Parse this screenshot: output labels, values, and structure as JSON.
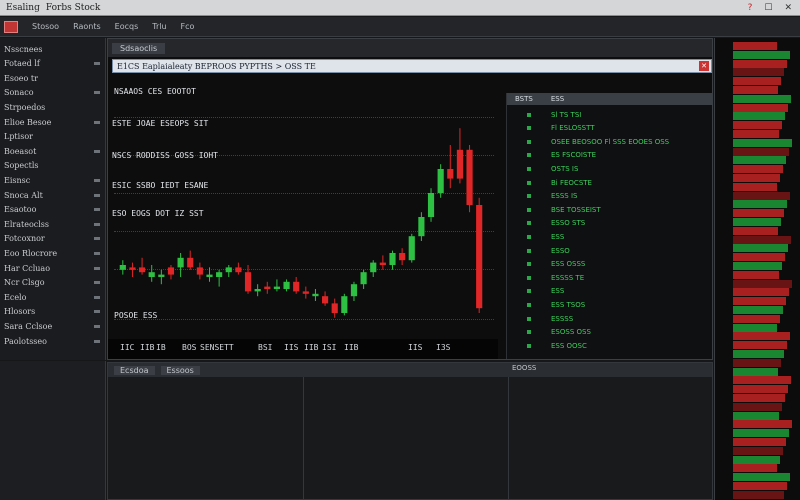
{
  "window": {
    "menu": [
      "Esaling",
      "Forbs Stock"
    ],
    "controls": [
      "?",
      "☐",
      "✕"
    ]
  },
  "toolbar": {
    "items": [
      "Stosoo",
      "Raonts",
      "Eocqs",
      "Trlu",
      "Fco"
    ]
  },
  "sidebar": {
    "items": [
      "Nsscnees",
      "Fotaed lf",
      "Esoeo tr",
      "Sonaco",
      "Strpoedos",
      "Elioe Besoe",
      "Lptisor",
      "Boeasot",
      "Sopectls",
      "Eisnsc",
      "Snoca Alt",
      "Esaotoo",
      "Elrateoclss",
      "Fotcoxnor",
      "Eoo Rlocrore",
      "Har Ccluao",
      "Ncr Clsgo",
      "Ecelo",
      "Hlosors",
      "Sara Cclsoe",
      "Paolotsseo"
    ]
  },
  "chart": {
    "tab": "Sdsaoclis",
    "title": "E1CS  Eaplaialeaty BEPROOS PYPTHS > OSS TE",
    "close_glyph": "✕",
    "annotations": {
      "a1": "NSAAOS CES  EOOTOT",
      "a2": "ESTE JOAE  ESEOPS SIT",
      "a3": "NSCS RODDISS GOSS IOHT",
      "a4": "ESIC SSBO IEDT ESANE",
      "a5": "ESO EOGS DOT IZ SST",
      "a6": "POSOE ESS"
    },
    "x_ticks": [
      "IIC",
      "IIB",
      "IB",
      "BOS",
      "SENSETT",
      "BSI",
      "IIS",
      "IIB",
      "ISI",
      "IIB",
      "IIS",
      "I3S"
    ],
    "chart_data": {
      "type": "candlestick",
      "candles": [
        {
          "o": 0.4,
          "h": 0.42,
          "l": 0.36,
          "c": 0.38,
          "up": true
        },
        {
          "o": 0.38,
          "h": 0.41,
          "l": 0.35,
          "c": 0.39,
          "up": false
        },
        {
          "o": 0.39,
          "h": 0.43,
          "l": 0.36,
          "c": 0.37,
          "up": false
        },
        {
          "o": 0.37,
          "h": 0.4,
          "l": 0.33,
          "c": 0.35,
          "up": true
        },
        {
          "o": 0.35,
          "h": 0.38,
          "l": 0.32,
          "c": 0.36,
          "up": true
        },
        {
          "o": 0.36,
          "h": 0.4,
          "l": 0.34,
          "c": 0.39,
          "up": false
        },
        {
          "o": 0.39,
          "h": 0.45,
          "l": 0.35,
          "c": 0.43,
          "up": true
        },
        {
          "o": 0.43,
          "h": 0.46,
          "l": 0.38,
          "c": 0.39,
          "up": false
        },
        {
          "o": 0.39,
          "h": 0.41,
          "l": 0.34,
          "c": 0.36,
          "up": false
        },
        {
          "o": 0.36,
          "h": 0.39,
          "l": 0.33,
          "c": 0.35,
          "up": true
        },
        {
          "o": 0.35,
          "h": 0.38,
          "l": 0.31,
          "c": 0.37,
          "up": true
        },
        {
          "o": 0.37,
          "h": 0.4,
          "l": 0.35,
          "c": 0.39,
          "up": true
        },
        {
          "o": 0.39,
          "h": 0.41,
          "l": 0.36,
          "c": 0.37,
          "up": false
        },
        {
          "o": 0.37,
          "h": 0.4,
          "l": 0.28,
          "c": 0.29,
          "up": false
        },
        {
          "o": 0.29,
          "h": 0.32,
          "l": 0.27,
          "c": 0.3,
          "up": true
        },
        {
          "o": 0.3,
          "h": 0.33,
          "l": 0.28,
          "c": 0.31,
          "up": false
        },
        {
          "o": 0.31,
          "h": 0.34,
          "l": 0.29,
          "c": 0.3,
          "up": true
        },
        {
          "o": 0.3,
          "h": 0.34,
          "l": 0.29,
          "c": 0.33,
          "up": true
        },
        {
          "o": 0.33,
          "h": 0.35,
          "l": 0.28,
          "c": 0.29,
          "up": false
        },
        {
          "o": 0.29,
          "h": 0.31,
          "l": 0.26,
          "c": 0.28,
          "up": false
        },
        {
          "o": 0.28,
          "h": 0.3,
          "l": 0.25,
          "c": 0.27,
          "up": true
        },
        {
          "o": 0.27,
          "h": 0.29,
          "l": 0.23,
          "c": 0.24,
          "up": false
        },
        {
          "o": 0.24,
          "h": 0.26,
          "l": 0.18,
          "c": 0.2,
          "up": false
        },
        {
          "o": 0.2,
          "h": 0.28,
          "l": 0.19,
          "c": 0.27,
          "up": true
        },
        {
          "o": 0.27,
          "h": 0.33,
          "l": 0.25,
          "c": 0.32,
          "up": true
        },
        {
          "o": 0.32,
          "h": 0.38,
          "l": 0.3,
          "c": 0.37,
          "up": true
        },
        {
          "o": 0.37,
          "h": 0.42,
          "l": 0.35,
          "c": 0.41,
          "up": true
        },
        {
          "o": 0.41,
          "h": 0.44,
          "l": 0.38,
          "c": 0.4,
          "up": false
        },
        {
          "o": 0.4,
          "h": 0.46,
          "l": 0.38,
          "c": 0.45,
          "up": true
        },
        {
          "o": 0.45,
          "h": 0.47,
          "l": 0.4,
          "c": 0.42,
          "up": false
        },
        {
          "o": 0.42,
          "h": 0.53,
          "l": 0.41,
          "c": 0.52,
          "up": true
        },
        {
          "o": 0.52,
          "h": 0.62,
          "l": 0.5,
          "c": 0.6,
          "up": true
        },
        {
          "o": 0.6,
          "h": 0.72,
          "l": 0.58,
          "c": 0.7,
          "up": true
        },
        {
          "o": 0.7,
          "h": 0.82,
          "l": 0.68,
          "c": 0.8,
          "up": true
        },
        {
          "o": 0.8,
          "h": 0.9,
          "l": 0.72,
          "c": 0.76,
          "up": false
        },
        {
          "o": 0.76,
          "h": 0.97,
          "l": 0.74,
          "c": 0.88,
          "up": false
        },
        {
          "o": 0.88,
          "h": 0.9,
          "l": 0.62,
          "c": 0.65,
          "up": false
        },
        {
          "o": 0.65,
          "h": 0.68,
          "l": 0.2,
          "c": 0.22,
          "up": false
        }
      ]
    }
  },
  "book": {
    "headers": [
      "BSTS",
      "ESS"
    ],
    "rows": [
      "Sl TS TSI",
      "Fl ESLOSSTT",
      "OSEE BEOSOO  Fl  SSS  EOOES  OSS",
      "ES FSCOISTE",
      "OSTS IS",
      "Bi FEOCSTE",
      "ESSS IS",
      "BSE TOSSEIST",
      "ESSO STS",
      "ESS",
      "ESSO",
      "ESS OSSS",
      "ESSSS TE",
      "ESS",
      "ESS TSOS",
      "ESSSS",
      "ESOSS OSS",
      "ESS OOSC"
    ]
  },
  "bottom": {
    "tabs": [
      "Ecsdoa",
      "Essoos"
    ],
    "right_tab": "EOOSS"
  },
  "ticker": {
    "colors": {
      "red": "#c62424",
      "green": "#1f9c3a",
      "dark_red": "#7a1616"
    }
  },
  "colors": {
    "up": "#2ec043",
    "down": "#e02626",
    "background": "#0d0d0e"
  }
}
